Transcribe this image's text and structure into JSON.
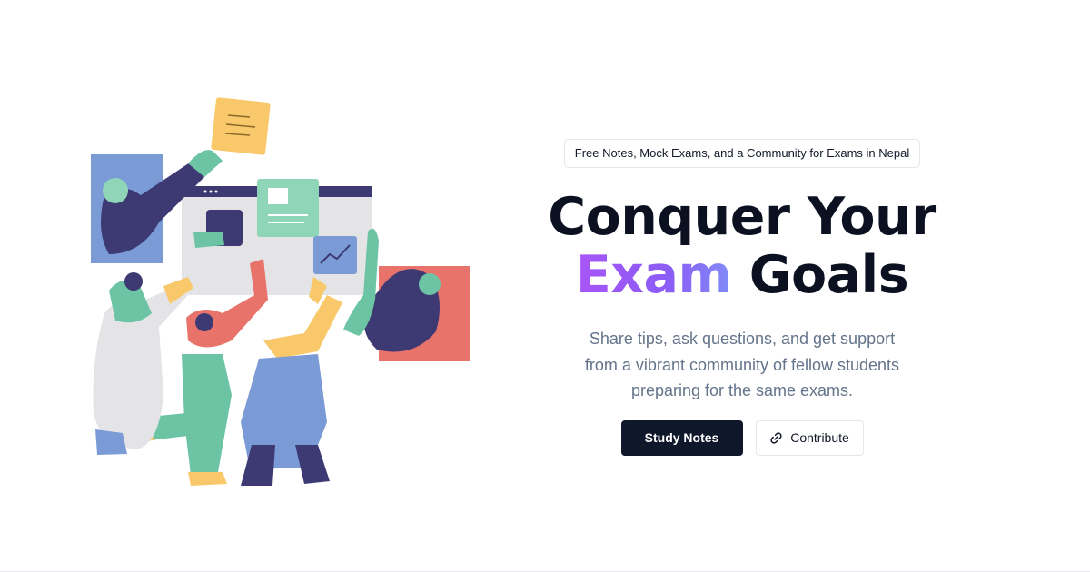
{
  "hero": {
    "badge": "Free Notes, Mock Exams, and a Community for Exams in Nepal",
    "headline_line1": "Conquer Your",
    "headline_accent": "Exam",
    "headline_rest": "Goals",
    "subtitle": "Share tips, ask questions, and get support from a vibrant community of fellow students preparing for the same exams.",
    "primary_button": "Study Notes",
    "secondary_button": "Contribute",
    "secondary_button_icon": "link-icon"
  },
  "illustration": {
    "name": "people-collaborating-illustration"
  },
  "colors": {
    "accent_gradient_start": "#a855f7",
    "accent_gradient_end": "#818cf8",
    "primary_button_bg": "#0f172a",
    "headline": "#0b1120",
    "subtitle": "#64748b"
  }
}
